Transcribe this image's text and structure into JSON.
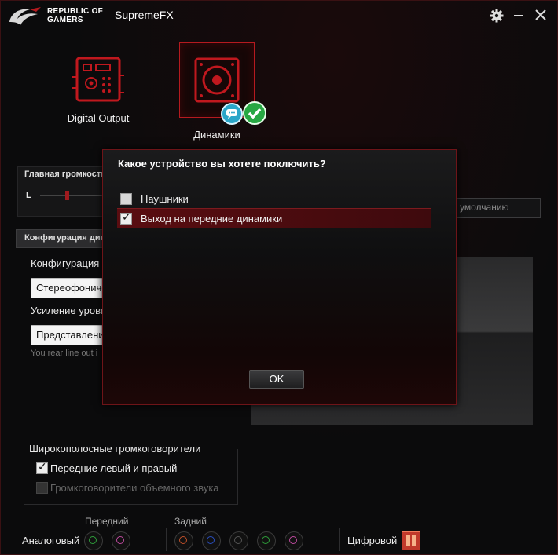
{
  "titlebar": {
    "brand_line1": "REPUBLIC OF",
    "brand_line2": "GAMERS",
    "app_title": "SupremeFX"
  },
  "devices": [
    {
      "label": "Digital Output",
      "icon": "digital-output-icon"
    },
    {
      "label": "Динамики",
      "icon": "speaker-icon",
      "selected": true
    }
  ],
  "volume": {
    "title": "Главная громкость",
    "channel_left": "L"
  },
  "default_button": "о умолчанию",
  "config": {
    "tab_label": "Конфигурация дин",
    "config_label": "Конфигурация д",
    "config_value": "Стереофоничес",
    "gain_label": "Усиление уровн",
    "gain_value": "Представление",
    "rear_note": "You rear line out i"
  },
  "wideband": {
    "title": "Широкополосные громкоговорители",
    "front": {
      "label": "Передние левый и правый",
      "checked": true
    },
    "surround": {
      "label": "Громкоговорители объемного звука",
      "checked": false,
      "disabled": true
    }
  },
  "jacks": {
    "front_header": "Передний",
    "rear_header": "Задний",
    "analog_label": "Аналоговый",
    "digital_label": "Цифровой",
    "front_colors": [
      "#2e9e3a",
      "#c04aa0"
    ],
    "rear_colors": [
      "#c0502a",
      "#2a4fc0",
      "#555555",
      "#2e9e3a",
      "#c04aa0"
    ]
  },
  "dialog": {
    "title": "Какое устройство вы хотете поключить?",
    "options": [
      {
        "label": "Наушники",
        "checked": false
      },
      {
        "label": "Выход на передние динамики",
        "checked": true
      }
    ],
    "ok_label": "OK"
  },
  "colors": {
    "accent": "#b51a1f",
    "background": "#0b0b0c"
  }
}
